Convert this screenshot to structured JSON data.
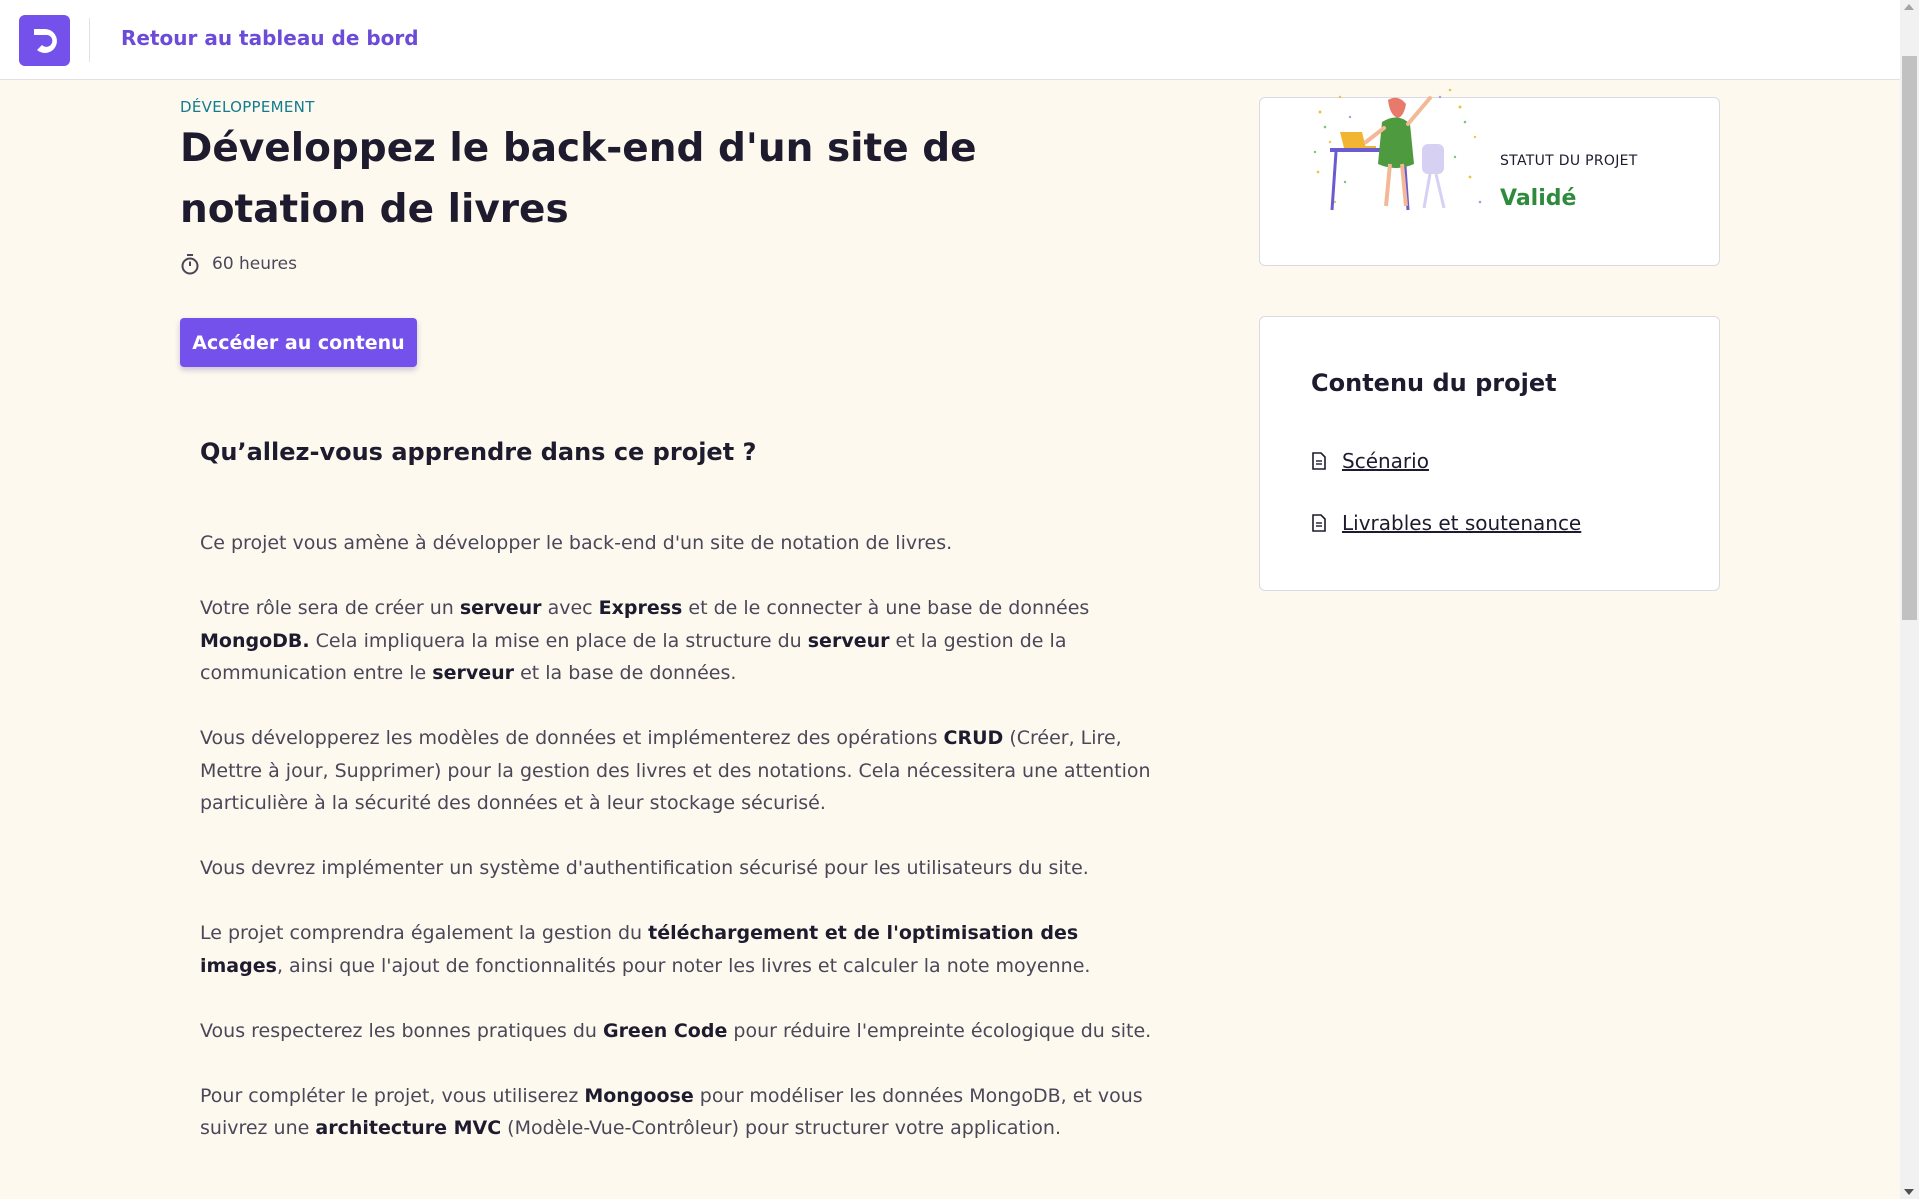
{
  "header": {
    "back_link": "Retour au tableau de bord"
  },
  "project": {
    "category": "DÉVELOPPEMENT",
    "title": "Développez le back-end d'un site de notation de livres",
    "duration": "60 heures",
    "cta_label": "Accéder au contenu"
  },
  "learn": {
    "heading": "Qu’allez-vous apprendre dans ce projet ?",
    "paragraphs": [
      "Ce projet vous amène à développer le back-end d'un site de notation de livres.",
      "Votre rôle sera de créer un serveur avec Express et de le connecter à une base de données MongoDB. Cela impliquera la mise en place de la structure du serveur et la gestion de la communication entre le serveur et la base de données.",
      "Vous développerez les modèles de données et implémenterez des opérations CRUD (Créer, Lire, Mettre à jour, Supprimer) pour la gestion des livres et des notations. Cela nécessitera une attention particulière à la sécurité des données et à leur stockage sécurisé.",
      "Vous devrez implémenter un système d'authentification sécurisé pour les utilisateurs du site.",
      "Le projet comprendra également la gestion du téléchargement et de l'optimisation des images, ainsi que l'ajout de fonctionnalités pour noter les livres et calculer la note moyenne.",
      "Vous respecterez les bonnes pratiques du Green Code pour réduire l'empreinte écologique du site.",
      "Pour compléter le projet, vous utiliserez Mongoose pour modéliser les données MongoDB, et vous suivrez une architecture MVC (Modèle-Vue-Contrôleur) pour structurer votre application."
    ],
    "bold_terms": [
      "serveur",
      "Express",
      "MongoDB.",
      "CRUD",
      "téléchargement et de l'optimisation des images",
      "Green Code",
      "Mongoose",
      "architecture MVC"
    ]
  },
  "status": {
    "label": "STATUT DU PROJET",
    "value": "Validé",
    "color": "#2e8b3d"
  },
  "content": {
    "title": "Contenu du projet",
    "items": [
      {
        "label": "Scénario",
        "icon": "document-icon"
      },
      {
        "label": "Livrables et soutenance",
        "icon": "document-icon"
      }
    ]
  },
  "colors": {
    "accent": "#7451eb",
    "background": "#fdf9ef",
    "category": "#127c8f"
  }
}
